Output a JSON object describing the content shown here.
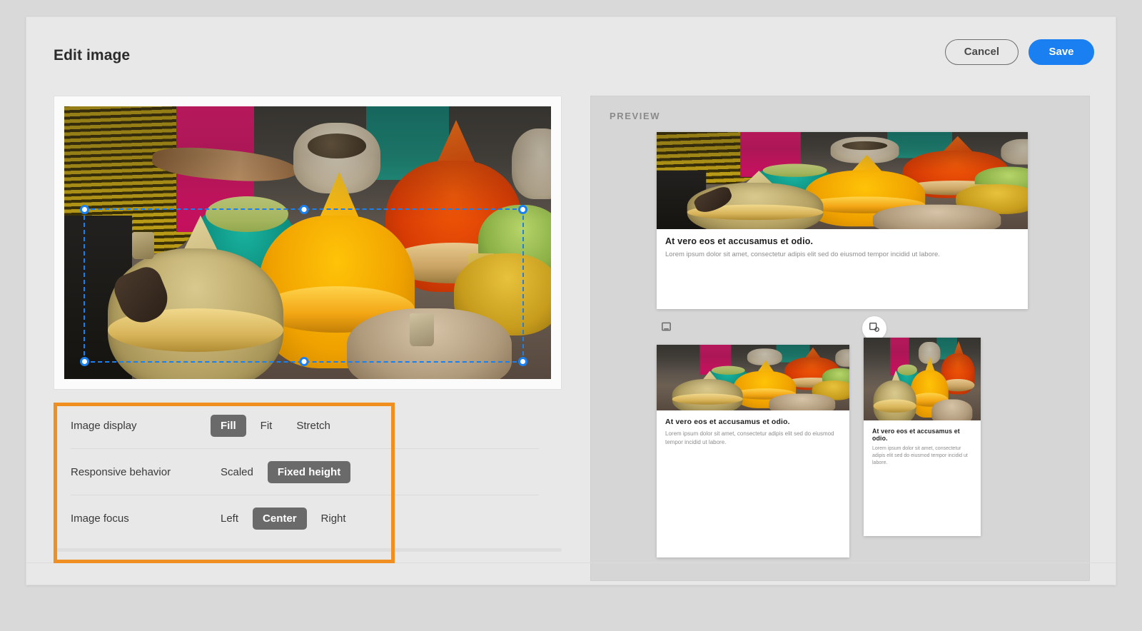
{
  "header": {
    "title": "Edit image",
    "cancel_label": "Cancel",
    "save_label": "Save"
  },
  "colors": {
    "accent_blue": "#1a7ff0",
    "highlight_orange": "#ef8f22",
    "segment_selected": "#6a6a6a",
    "panel_bg": "#e8e8e8",
    "preview_bg": "#d6d6d6"
  },
  "editor": {
    "crop_selection_active": true,
    "handle_count": 6
  },
  "settings": [
    {
      "label": "Image display",
      "options": [
        "Fill",
        "Fit",
        "Stretch"
      ],
      "selected": "Fill"
    },
    {
      "label": "Responsive behavior",
      "options": [
        "Scaled",
        "Fixed height"
      ],
      "selected": "Fixed height"
    },
    {
      "label": "Image focus",
      "options": [
        "Left",
        "Center",
        "Right"
      ],
      "selected": "Center"
    }
  ],
  "preview": {
    "title": "PREVIEW",
    "devices": [
      {
        "name": "desktop-icon",
        "active": false
      },
      {
        "name": "tablet-icon",
        "active": true
      }
    ],
    "cards": {
      "heading": "At vero eos et accusamus et odio.",
      "body": "Lorem ipsum dolor sit amet, consectetur adipis elit sed do eiusmod tempor incidid ut labore."
    }
  }
}
